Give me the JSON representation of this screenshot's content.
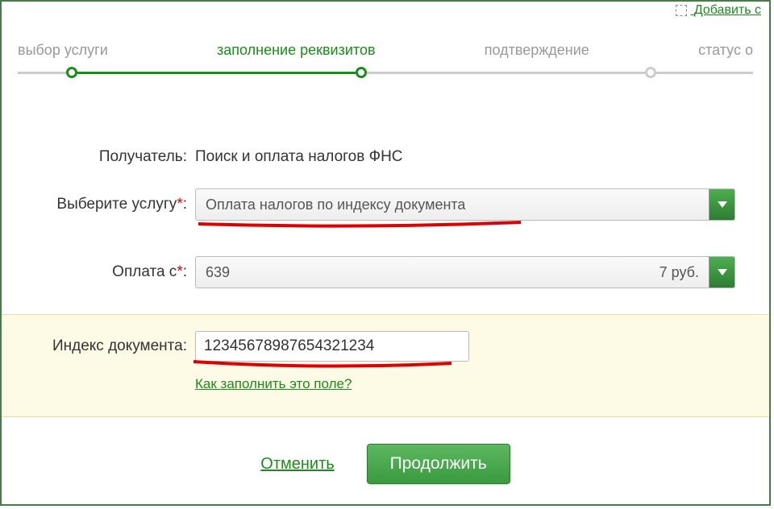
{
  "topLink": "Добавить с",
  "stepper": {
    "steps": [
      "выбор услуги",
      "заполнение реквизитов",
      "подтверждение",
      "статус о"
    ],
    "activeIndex": 1
  },
  "form": {
    "recipient": {
      "label": "Получатель:",
      "value": "Поиск и оплата налогов ФНС"
    },
    "service": {
      "label": "Выберите услугу",
      "selected": "Оплата налогов по индексу документа"
    },
    "payFrom": {
      "label": "Оплата с",
      "selected_prefix": "639",
      "selected_suffix": "7 руб."
    },
    "docIndex": {
      "label": "Индекс документа:",
      "value": "12345678987654321234",
      "help": "Как заполнить это поле?"
    }
  },
  "actions": {
    "cancel": "Отменить",
    "continue": "Продолжить"
  }
}
